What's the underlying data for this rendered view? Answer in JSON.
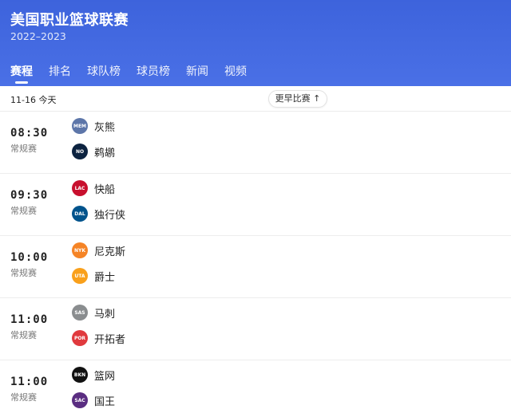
{
  "header": {
    "title": "美国职业篮球联赛",
    "season": "2022–2023"
  },
  "tabs": [
    "赛程",
    "排名",
    "球队榜",
    "球员榜",
    "新闻",
    "视频"
  ],
  "datebar": {
    "date": "11-16 今天",
    "earlier_label": "更早比赛 ↑"
  },
  "colors": {
    "header": "#4268e0",
    "tab_indicator": "#ffffff"
  },
  "matches": [
    {
      "time": "08:30",
      "type": "常规赛",
      "home": {
        "name": "灰熊",
        "logo": "grizzlies-logo",
        "color": "#5d76a9"
      },
      "away": {
        "name": "鹈鹕",
        "logo": "pelicans-logo",
        "color": "#0c2340"
      }
    },
    {
      "time": "09:30",
      "type": "常规赛",
      "home": {
        "name": "快船",
        "logo": "clippers-logo",
        "color": "#c8102e"
      },
      "away": {
        "name": "独行侠",
        "logo": "mavericks-logo",
        "color": "#00538c"
      }
    },
    {
      "time": "10:00",
      "type": "常规赛",
      "home": {
        "name": "尼克斯",
        "logo": "knicks-logo",
        "color": "#f58426"
      },
      "away": {
        "name": "爵士",
        "logo": "jazz-logo",
        "color": "#f9a01b"
      }
    },
    {
      "time": "11:00",
      "type": "常规赛",
      "home": {
        "name": "马刺",
        "logo": "spurs-logo",
        "color": "#8a8d8f"
      },
      "away": {
        "name": "开拓者",
        "logo": "blazers-logo",
        "color": "#e03a3e"
      }
    },
    {
      "time": "11:00",
      "type": "常规赛",
      "home": {
        "name": "篮网",
        "logo": "nets-logo",
        "color": "#111111"
      },
      "away": {
        "name": "国王",
        "logo": "kings-logo",
        "color": "#5a2d81"
      }
    }
  ]
}
